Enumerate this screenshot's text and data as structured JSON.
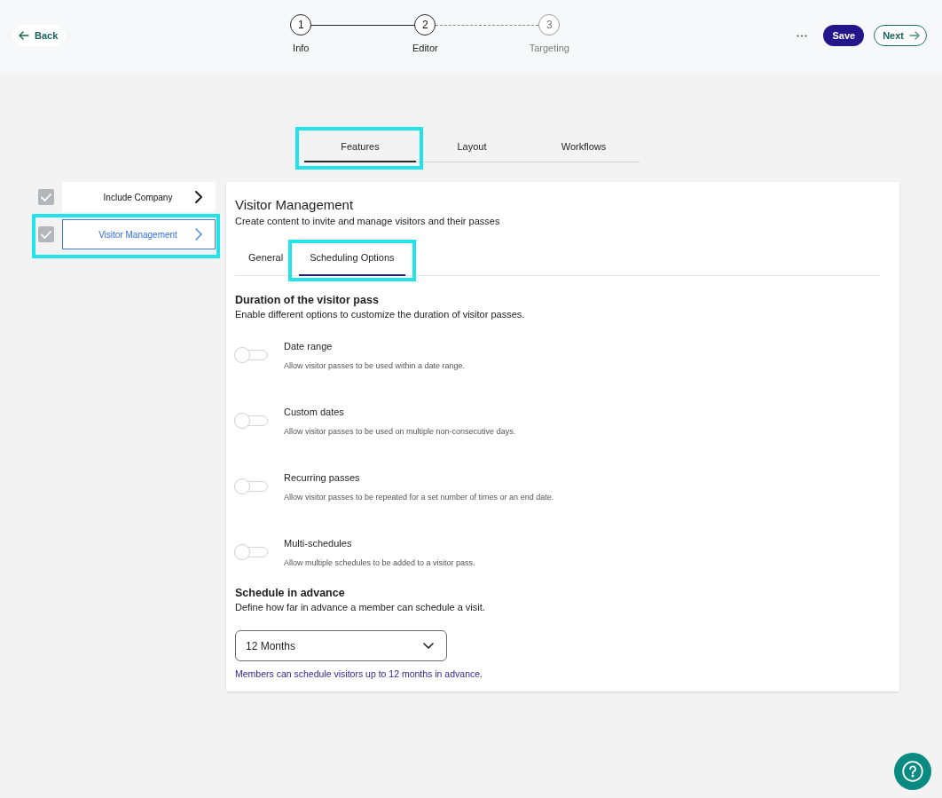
{
  "top_bar": {
    "back": "Back",
    "steps": [
      {
        "number": "1",
        "label": "Info",
        "reached": true
      },
      {
        "number": "2",
        "label": "Editor",
        "reached": true
      },
      {
        "number": "3",
        "label": "Targeting",
        "reached": false
      }
    ],
    "save": "Save",
    "next": "Next"
  },
  "tabs": [
    {
      "label": "Features",
      "selected": true,
      "highlighted": true
    },
    {
      "label": "Layout",
      "selected": false,
      "highlighted": false
    },
    {
      "label": "Workflows",
      "selected": false,
      "highlighted": false
    }
  ],
  "sidebar": {
    "items": [
      {
        "label": "Include Company",
        "checked": true,
        "selected": false,
        "highlighted": false
      },
      {
        "label": "Visitor Management",
        "checked": true,
        "selected": true,
        "highlighted": true
      }
    ]
  },
  "panel": {
    "title": "Visitor Management",
    "subtitle": "Create content to invite and manage visitors and their passes",
    "tabs": [
      {
        "label": "General",
        "selected": false,
        "highlighted": false
      },
      {
        "label": "Scheduling Options",
        "selected": true,
        "highlighted": true
      }
    ],
    "duration": {
      "heading": "Duration of the visitor pass",
      "description": "Enable different options to customize the duration of visitor passes.",
      "options": [
        {
          "label": "Date range",
          "description": "Allow visitor passes to be used within a date range.",
          "on": false
        },
        {
          "label": "Custom dates",
          "description": "Allow visitor passes to be used on multiple non-consecutive days.",
          "on": false
        },
        {
          "label": "Recurring passes",
          "description": "Allow visitor passes to be repeated for a set number of times or an end date.",
          "on": false
        },
        {
          "label": "Multi-schedules",
          "description": "Allow multiple schedules to be added to a visitor pass.",
          "on": false
        }
      ]
    },
    "advance": {
      "heading": "Schedule in advance",
      "description": "Define how far in advance a member can schedule a visit.",
      "select": {
        "value": "12 Months"
      },
      "helper": "Members can schedule visitors up to 12 months in advance."
    }
  }
}
